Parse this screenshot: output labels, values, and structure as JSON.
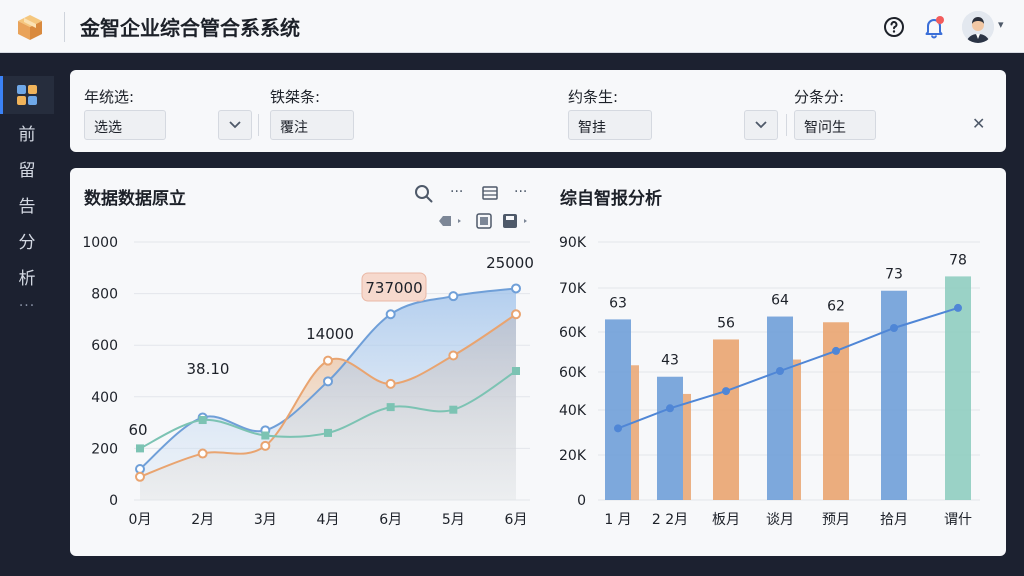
{
  "header": {
    "title": "金智企业综合管合系系统"
  },
  "sidebar": {
    "items": [
      {
        "label": "前"
      },
      {
        "label": "留"
      },
      {
        "label": "告"
      },
      {
        "label": "分"
      },
      {
        "label": "析"
      }
    ],
    "more": "···"
  },
  "filters": {
    "f1": {
      "label": "年统选:",
      "value": "选选"
    },
    "f2": {
      "label": "铁桀条:",
      "value": "覆注"
    },
    "f3": {
      "label": "约条生:",
      "value": "智挂"
    },
    "f4": {
      "label": "分条分:",
      "value": "智问生"
    }
  },
  "panels": {
    "left_title": "数据数据原立",
    "right_title": "综自智报分析"
  },
  "colors": {
    "blue": "#6f9fd8",
    "orange": "#e9a470",
    "teal": "#7cc3b3",
    "green": "#8fcdc0"
  },
  "chart_data": [
    {
      "type": "area",
      "title": "数据数据原立",
      "x": [
        "0月",
        "2月",
        "3月",
        "4月",
        "6月",
        "5月",
        "6月"
      ],
      "ytick_labels": [
        "0",
        "200",
        "400",
        "600",
        "800",
        "1000"
      ],
      "ylim": [
        0,
        1000
      ],
      "series": [
        {
          "values": [
            120,
            320,
            270,
            460,
            720,
            790,
            820
          ]
        },
        {
          "values": [
            90,
            180,
            210,
            540,
            450,
            560,
            720
          ]
        },
        {
          "values": [
            200,
            310,
            250,
            260,
            360,
            350,
            500
          ]
        }
      ],
      "data_labels": [
        "60",
        "38.10",
        "14000",
        "737000",
        "25000"
      ],
      "grid": true
    },
    {
      "type": "bar",
      "title": "综自智报分析",
      "categories": [
        "1 月",
        "2 2月",
        "板月",
        "谈月",
        "预月",
        "拾月",
        "谓什"
      ],
      "ytick_labels": [
        "0",
        "20K",
        "40K",
        "60K",
        "60K",
        "70K",
        "90K"
      ],
      "series": [
        {
          "values": [
            63,
            43,
            56,
            64,
            62,
            73,
            78
          ]
        },
        {
          "values": [
            47,
            37,
            0,
            49,
            0,
            0,
            0
          ]
        },
        {
          "values": [
            25,
            32,
            38,
            45,
            52,
            60,
            67
          ]
        }
      ],
      "data_labels": [
        "63",
        "43",
        "56",
        "64",
        "62",
        "73",
        "78"
      ],
      "grid": true
    }
  ]
}
